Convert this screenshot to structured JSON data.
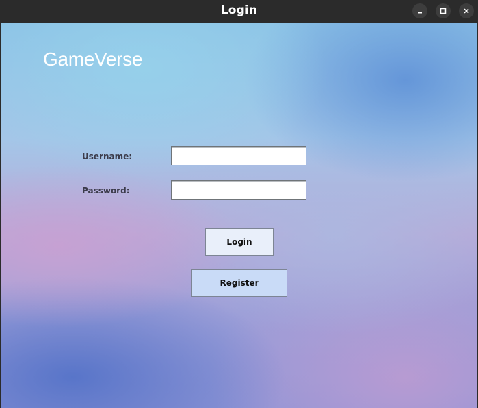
{
  "window": {
    "title": "Login",
    "controls": {
      "minimize": "minimize-icon",
      "maximize": "maximize-icon",
      "close": "close-icon"
    }
  },
  "brand": {
    "name": "GameVerse"
  },
  "form": {
    "username_label": "Username:",
    "username_value": "",
    "password_label": "Password:",
    "password_value": "",
    "login_label": "Login",
    "register_label": "Register"
  },
  "colors": {
    "titlebar": "#2b2b2b",
    "login_button": "#e9effa",
    "register_button": "#c9dbf7"
  }
}
